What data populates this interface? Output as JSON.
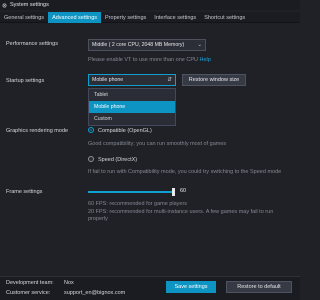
{
  "window": {
    "title": "System settings"
  },
  "tabs": [
    {
      "label": "General settings"
    },
    {
      "label": "Advanced settings"
    },
    {
      "label": "Property settings"
    },
    {
      "label": "Interface settings"
    },
    {
      "label": "Shortcut settings"
    }
  ],
  "performance": {
    "label": "Performance settings",
    "value": "Middle ( 2 core CPU, 2048 MB Memory)",
    "hint_prefix": "Please enable VT to use more than one CPU",
    "hint_link": "Help"
  },
  "startup": {
    "label": "Startup settings",
    "value": "Mobile phone",
    "options": [
      "Tablet",
      "Mobile phone",
      "Custom"
    ],
    "selected_index": 1,
    "restore_button": "Restore window size"
  },
  "graphics": {
    "label": "Graphics rendering mode",
    "option1": "Compatible (OpenGL)",
    "option1_desc": "Good compatibility; you can run smoothly most of games",
    "option2": "Speed (DirectX)",
    "option2_desc": "If fail to run with Compatibility mode, you could try switching to the Speed mode",
    "selected": "option1"
  },
  "frames": {
    "label": "Frame settings",
    "value": "60",
    "value_fraction": 1.0,
    "hint1": "60 FPS: recommended for game players",
    "hint2": "20 FPS: recommended for multi-instance users. A few games may fail to run properly"
  },
  "footer": {
    "team_label": "Development team:",
    "team_value": "Nox",
    "service_label": "Customer service:",
    "service_value": "support_en@bignox.com",
    "save_button": "Save settings",
    "restore_default_button": "Restore to default"
  },
  "colors": {
    "accent": "#0e94c2",
    "background": "#1f2127",
    "panel": "#1a1c21"
  }
}
